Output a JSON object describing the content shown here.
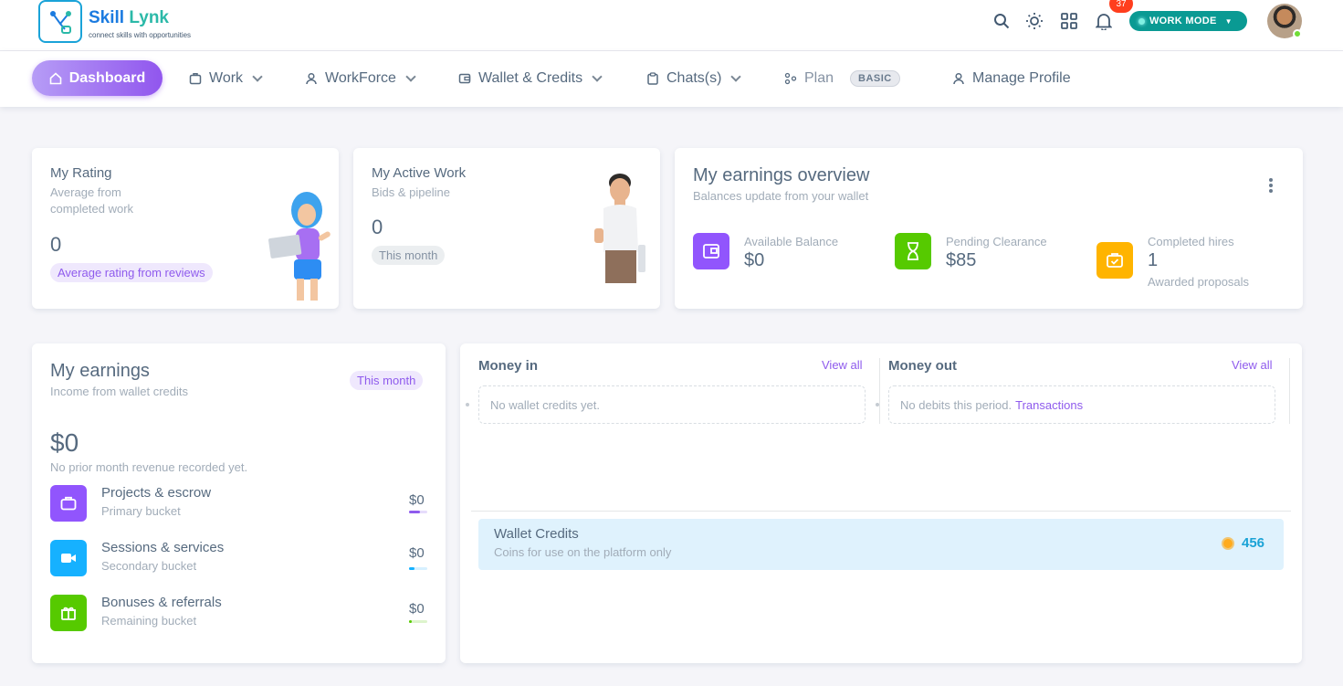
{
  "brand": {
    "name_part1": "Skill",
    "name_part2": "Lynk",
    "tagline": "connect skills with opportunities"
  },
  "header": {
    "notification_count": "37",
    "work_mode_label": "WORK MODE"
  },
  "nav": {
    "dashboard": "Dashboard",
    "work": "Work",
    "workforce": "WorkForce",
    "wallet": "Wallet & Credits",
    "chats": "Chats(s)",
    "plan": "Plan",
    "plan_badge": "BASIC",
    "manage_profile": "Manage Profile"
  },
  "rating_card": {
    "title": "My Rating",
    "subtitle_line1": "Average from",
    "subtitle_line2": "completed work",
    "value": "0",
    "pill": "Average rating from reviews"
  },
  "active_work_card": {
    "title": "My Active Work",
    "subtitle": "Bids & pipeline",
    "value": "0",
    "pill": "This month"
  },
  "overview": {
    "title": "My earnings overview",
    "subtitle": "Balances update from your wallet",
    "available_label": "Available Balance",
    "available_value": "$0",
    "pending_label": "Pending Clearance",
    "pending_value": "$85",
    "hires_label": "Completed hires",
    "hires_value": "1",
    "hires_sub": "Awarded proposals"
  },
  "earnings": {
    "title": "My earnings",
    "subtitle": "Income from wallet credits",
    "pill": "This month",
    "total": "$0",
    "note": "No prior month revenue recorded yet.",
    "rows": [
      {
        "title": "Projects & escrow",
        "sub": "Primary bucket",
        "amount": "$0",
        "progress": 0.6,
        "color": "#8f5bed",
        "track": "#e6dcfb",
        "icon_bg": "#9155fd"
      },
      {
        "title": "Sessions & services",
        "sub": "Secondary bucket",
        "amount": "$0",
        "progress": 0.3,
        "color": "#16b1ff",
        "track": "#d6f0ff",
        "icon_bg": "#16b1ff"
      },
      {
        "title": "Bonuses & referrals",
        "sub": "Remaining bucket",
        "amount": "$0",
        "progress": 0.15,
        "color": "#56ca00",
        "track": "#ddf4cc",
        "icon_bg": "#56ca00"
      }
    ]
  },
  "money": {
    "in_title": "Money in",
    "in_view_all": "View all",
    "in_empty": "No wallet credits yet.",
    "out_title": "Money out",
    "out_view_all": "View all",
    "out_empty": "No debits this period.",
    "out_link": "Transactions"
  },
  "wallet_credits": {
    "title": "Wallet Credits",
    "subtitle": "Coins for use on the platform only",
    "value": "456"
  }
}
